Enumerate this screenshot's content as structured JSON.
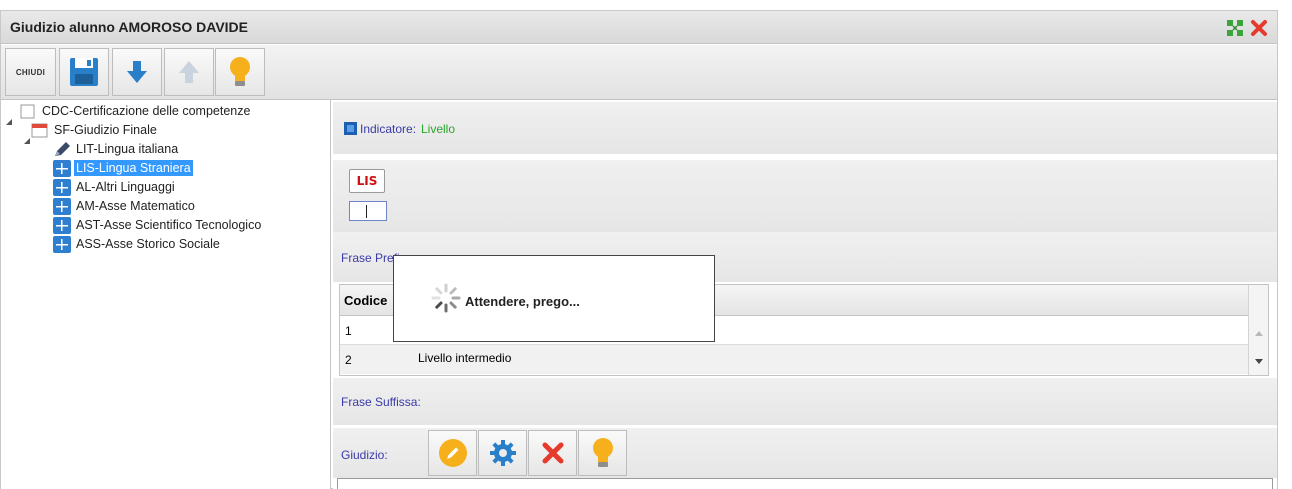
{
  "window": {
    "title": "Giudizio alunno AMOROSO DAVIDE"
  },
  "toolbar": {
    "close_label": "CHIUDI"
  },
  "tree": {
    "root": "CDC-Certificazione delle competenze",
    "group": "SF-Giudizio Finale",
    "items": [
      {
        "label": "LIT-Lingua italiana",
        "icon": "pencil-icon",
        "selected": false
      },
      {
        "label": "LIS-Lingua Straniera",
        "icon": "grid-icon",
        "selected": true
      },
      {
        "label": "AL-Altri Linguaggi",
        "icon": "grid-icon",
        "selected": false
      },
      {
        "label": "AM-Asse Matematico",
        "icon": "grid-icon",
        "selected": false
      },
      {
        "label": "AST-Asse Scientifico Tecnologico",
        "icon": "grid-icon",
        "selected": false
      },
      {
        "label": "ASS-Asse Storico Sociale",
        "icon": "grid-icon",
        "selected": false
      }
    ]
  },
  "panel": {
    "indicator_label": "Indicatore:",
    "indicator_value": "Livello",
    "code_button": "LIS",
    "prefix_label": "Frase Prefissa:",
    "suffix_label": "Frase Suffissa:",
    "judgement_label": "Giudizio:"
  },
  "table": {
    "header_code": "Codice",
    "rows": [
      {
        "code": "1",
        "description": ""
      },
      {
        "code": "2",
        "description": "Livello intermedio"
      }
    ]
  },
  "loading": {
    "message": "Attendere, prego..."
  },
  "colors": {
    "selection": "#3399ff",
    "label_blue": "#3a3aa8",
    "label_green": "#2aa52a",
    "close_red": "#e53b2c",
    "save_blue": "#2a7fc9"
  }
}
